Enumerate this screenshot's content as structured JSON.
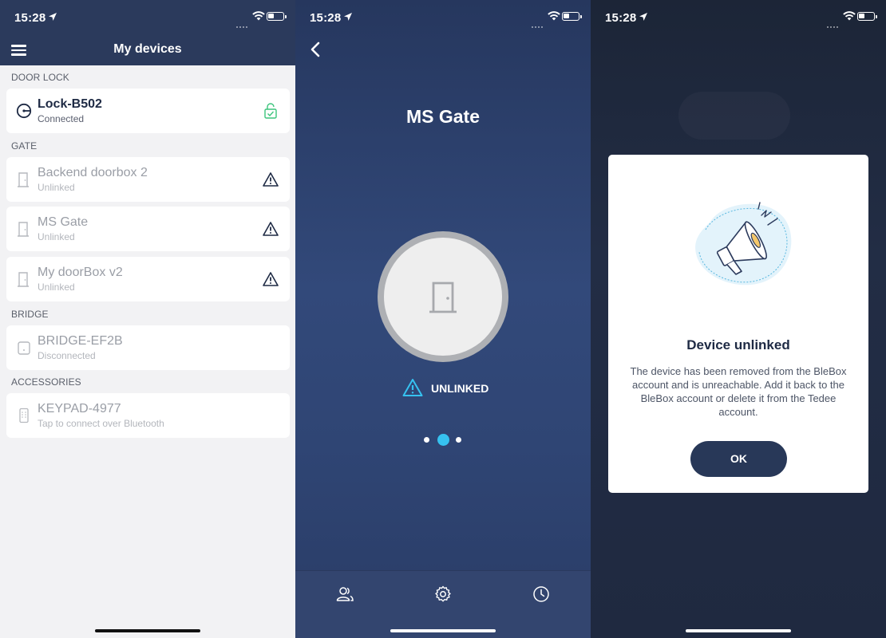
{
  "status_bar": {
    "time": "15:28"
  },
  "screen1": {
    "title": "My devices",
    "sections": [
      {
        "label": "DOOR LOCK"
      },
      {
        "label": "GATE"
      },
      {
        "label": "BRIDGE"
      },
      {
        "label": "ACCESSORIES"
      }
    ],
    "devices": [
      {
        "name": "Lock-B502",
        "status": "Connected",
        "icon": "lock-circle-icon",
        "right_icon": "unlocked-check-icon"
      },
      {
        "name": "Backend doorbox 2",
        "status": "Unlinked",
        "icon": "door-icon",
        "right_icon": "warning-icon"
      },
      {
        "name": "MS Gate",
        "status": "Unlinked",
        "icon": "door-icon",
        "right_icon": "warning-icon"
      },
      {
        "name": "My doorBox v2",
        "status": "Unlinked",
        "icon": "door-icon",
        "right_icon": "warning-icon"
      },
      {
        "name": "BRIDGE-EF2B",
        "status": "Disconnected",
        "icon": "bridge-icon"
      },
      {
        "name": "KEYPAD-4977",
        "status": "Tap to connect over Bluetooth",
        "icon": "keypad-icon"
      }
    ]
  },
  "screen2": {
    "title": "MS Gate",
    "state_label": "UNLINKED",
    "pager": {
      "count": 3,
      "active": 2
    },
    "tabs": [
      {
        "icon": "users-icon"
      },
      {
        "icon": "settings-gear-icon"
      },
      {
        "icon": "history-clock-icon"
      }
    ]
  },
  "screen3": {
    "modal": {
      "title": "Device unlinked",
      "body": "The device has been removed from the BleBox account and is unreachable. Add it back to the BleBox account or delete it from the Tedee account.",
      "ok_label": "OK"
    }
  },
  "colors": {
    "navy": "#2b3a5c",
    "accent_blue": "#36c2f0",
    "connected_green": "#3cc47c",
    "screen_bg": "#f2f2f4"
  }
}
